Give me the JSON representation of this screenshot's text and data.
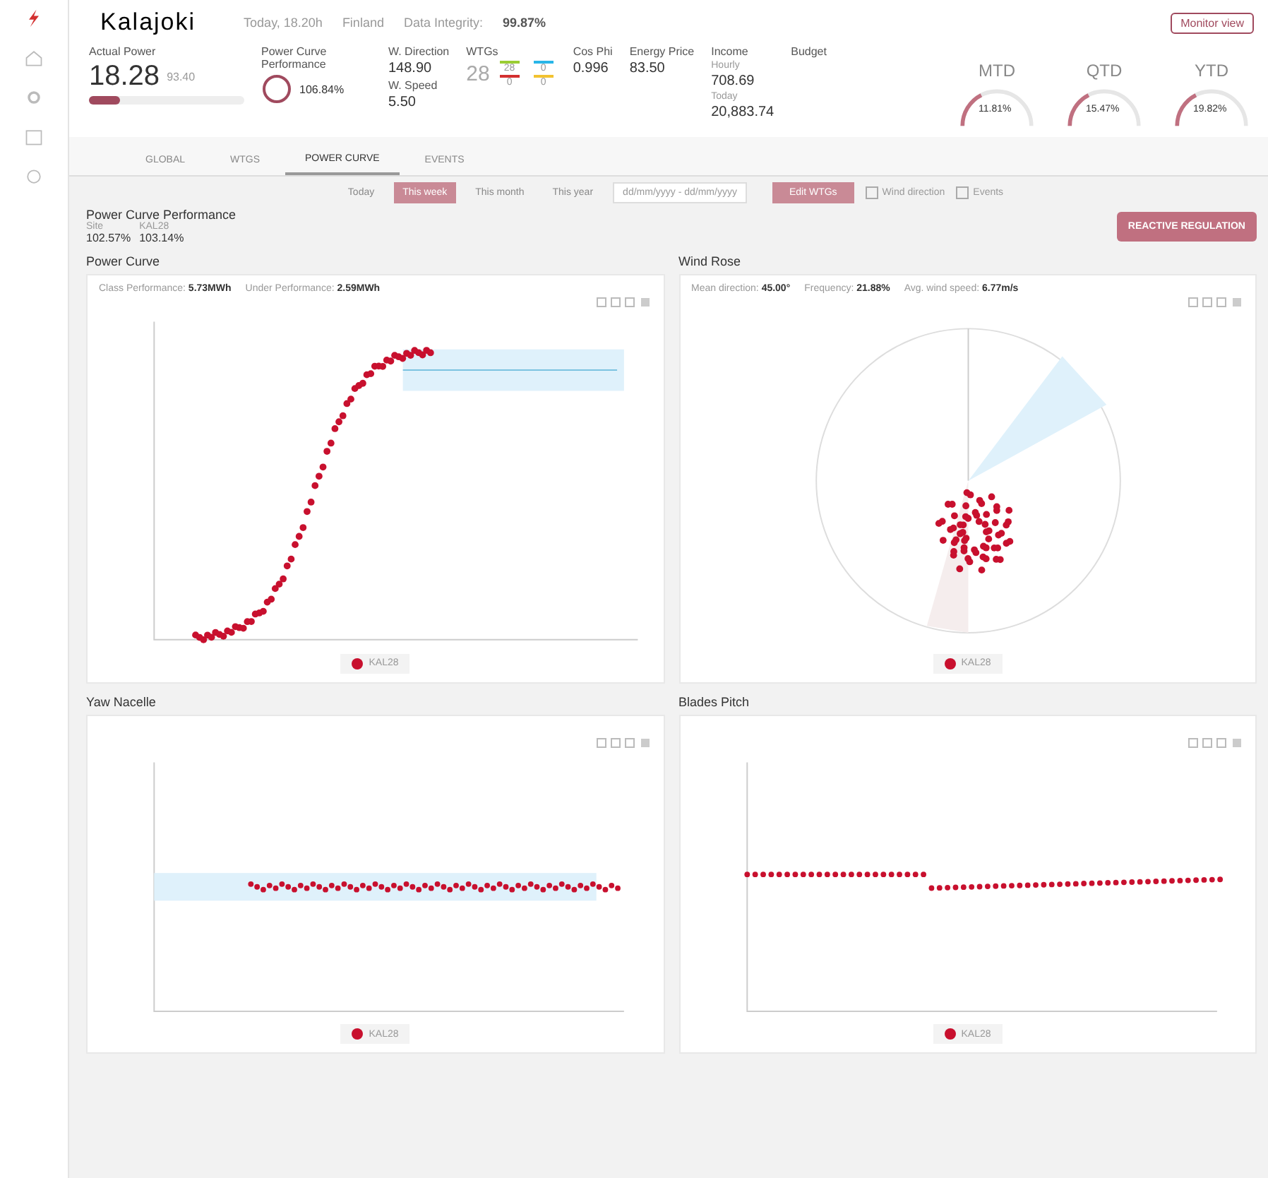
{
  "header": {
    "site": "Kalajoki",
    "date": "Today, 18.20h",
    "country": "Finland",
    "integrity_label": "Data Integrity:",
    "integrity": "99.87%",
    "action": "Monitor view"
  },
  "kpis": {
    "actual_power": {
      "label": "Actual Power",
      "value": "18.28",
      "sub": "93.40",
      "level": 0.2
    },
    "pcp": {
      "label": "Power Curve Performance",
      "value": "106.84%"
    },
    "wind": {
      "dir_label": "W. Direction",
      "dir": "148.90",
      "speed_label": "W. Speed",
      "speed": "5.50"
    },
    "wtgs": {
      "label": "WTGs",
      "total": "28",
      "states": [
        {
          "color": "#9acd32",
          "count": "28"
        },
        {
          "color": "#29b6e8",
          "count": "0"
        },
        {
          "color": "#d32f2f",
          "count": "0"
        },
        {
          "color": "#f2c230",
          "count": "0"
        }
      ]
    },
    "cos_phi": {
      "label": "Cos Phi",
      "value": "0.996"
    },
    "energy_price": {
      "label": "Energy Price",
      "value": "83.50"
    },
    "income": {
      "label": "Income",
      "hourly_label": "Hourly",
      "hourly": "708.69",
      "today_label": "Today",
      "today": "20,883.74"
    },
    "budget": {
      "label": "Budget",
      "items": [
        {
          "name": "MTD",
          "value": "11.81%"
        },
        {
          "name": "QTD",
          "value": "15.47%"
        },
        {
          "name": "YTD",
          "value": "19.82%"
        }
      ]
    }
  },
  "tabs": [
    {
      "label": "GLOBAL",
      "selected": false
    },
    {
      "label": "WTGS",
      "selected": false
    },
    {
      "label": "POWER CURVE",
      "selected": true
    },
    {
      "label": "EVENTS",
      "selected": false
    }
  ],
  "periods": [
    {
      "label": "Today",
      "selected": false
    },
    {
      "label": "This week",
      "selected": true
    },
    {
      "label": "This month",
      "selected": false
    },
    {
      "label": "This year",
      "selected": false
    }
  ],
  "date_range": "dd/mm/yyyy - dd/mm/yyyy",
  "edit_button": "Edit WTGs",
  "options": [
    {
      "label": "Wind direction",
      "checked": false
    },
    {
      "label": "Events",
      "checked": false
    }
  ],
  "pcp_section": {
    "title": "Power Curve Performance",
    "values": [
      {
        "label": "Site",
        "value": "102.57%"
      },
      {
        "label": "KAL28",
        "value": "103.14%"
      }
    ],
    "button": "REACTIVE REGULATION"
  },
  "panels": [
    {
      "kind": "power",
      "title": "Power Curve",
      "info": [
        {
          "label": "Class Performance:",
          "value": "5.73MWh"
        },
        {
          "label": "Under Performance:",
          "value": "2.59MWh"
        }
      ],
      "legend": "KAL28"
    },
    {
      "kind": "rose",
      "title": "Wind Rose",
      "info": [
        {
          "label": "Mean direction:",
          "value": "45.00°"
        },
        {
          "label": "Frequency:",
          "value": "21.88%"
        },
        {
          "label": "Avg. wind speed:",
          "value": "6.77m/s"
        }
      ],
      "legend": "KAL28"
    },
    {
      "kind": "yaw",
      "title": "Yaw Nacelle",
      "legend": "KAL28"
    },
    {
      "kind": "pitch",
      "title": "Blades Pitch",
      "legend": "KAL28"
    }
  ]
}
